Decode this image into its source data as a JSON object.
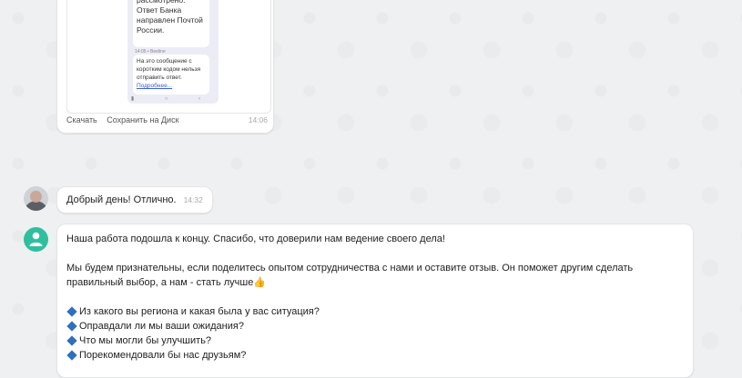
{
  "attachment": {
    "sms1_text": "рассмотрено. Ответ Банка направлен Почтой России.",
    "sms_meta": "14:05 • Beeline",
    "sms2_text": "На это сообщение с коротким кодом нельзя отправить ответ.",
    "sms2_link": "Подробнее...",
    "download_label": "Скачать",
    "save_label": "Сохранить на Диск",
    "time": "14:06"
  },
  "reply": {
    "text": "Добрый день! Отлично.",
    "time": "14:32"
  },
  "operator_message": {
    "para1": "Наша работа подошла к концу. Спасибо, что доверили нам ведение своего дела!",
    "para2": "Мы будем признательны, если поделитесь опытом сотрудничества с нами и оставите отзыв. Он поможет другим сделать правильный выбор, а нам - стать лучше👍",
    "questions": [
      "Из какого вы региона и какая была у вас ситуация?",
      "Оправдали ли мы ваши ожидания?",
      "Что мы могли бы улучшить?",
      "Порекомендовали бы нас друзьям?"
    ]
  },
  "colors": {
    "accent": "#2fbf9e",
    "diamond": "#2f6fbf"
  }
}
